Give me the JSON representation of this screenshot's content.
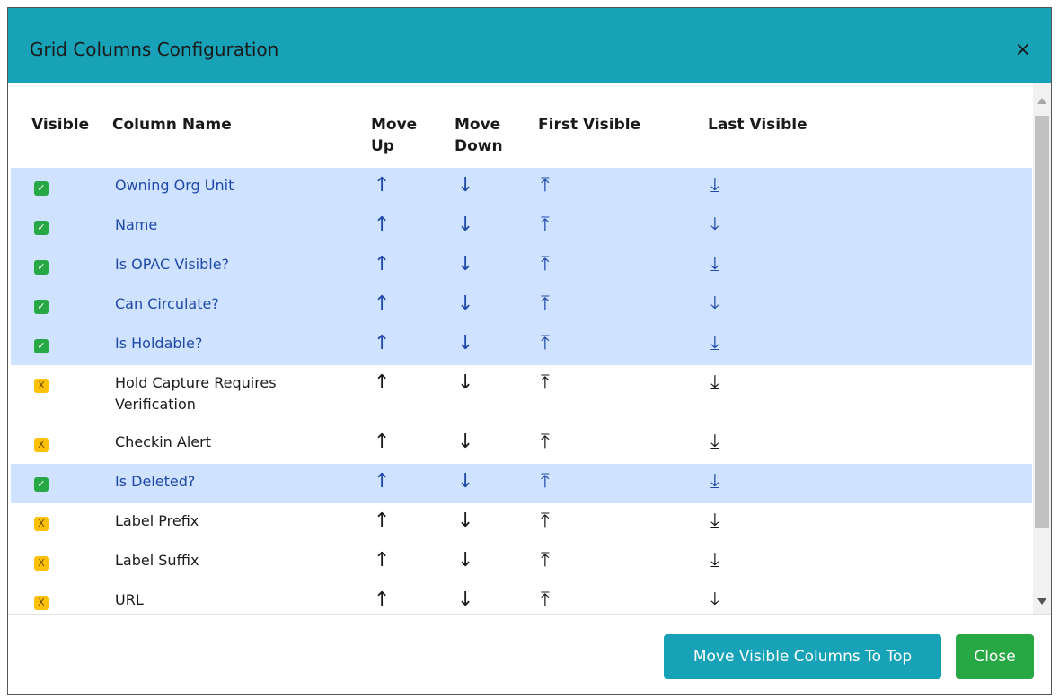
{
  "modal": {
    "title": "Grid Columns Configuration",
    "close_glyph": "×"
  },
  "columns": {
    "visible": "Visible",
    "column_name": "Column Name",
    "move_up_l1": "Move",
    "move_up_l2": "Up",
    "move_down_l1": "Move",
    "move_down_l2": "Down",
    "first_visible": "First Visible",
    "last_visible": "Last Visible"
  },
  "glyphs": {
    "check": "✓",
    "x": "X",
    "up": "↑",
    "down": "↓",
    "first": "⤒",
    "last": "⤓"
  },
  "rows": [
    {
      "name": "Owning Org Unit",
      "visible": true
    },
    {
      "name": "Name",
      "visible": true
    },
    {
      "name": "Is OPAC Visible?",
      "visible": true
    },
    {
      "name": "Can Circulate?",
      "visible": true
    },
    {
      "name": "Is Holdable?",
      "visible": true
    },
    {
      "name": "Hold Capture Requires Verification",
      "visible": false
    },
    {
      "name": "Checkin Alert",
      "visible": false
    },
    {
      "name": "Is Deleted?",
      "visible": true
    },
    {
      "name": "Label Prefix",
      "visible": false
    },
    {
      "name": "Label Suffix",
      "visible": false
    },
    {
      "name": "URL",
      "visible": false
    }
  ],
  "footer": {
    "move_visible_label": "Move Visible Columns To Top",
    "close_label": "Close"
  },
  "colors": {
    "header": "#17a2b8",
    "visible_row": "#cfe2ff",
    "visible_check": "#28a745",
    "hidden_check": "#ffc107",
    "link_text": "#1f4aa8"
  }
}
